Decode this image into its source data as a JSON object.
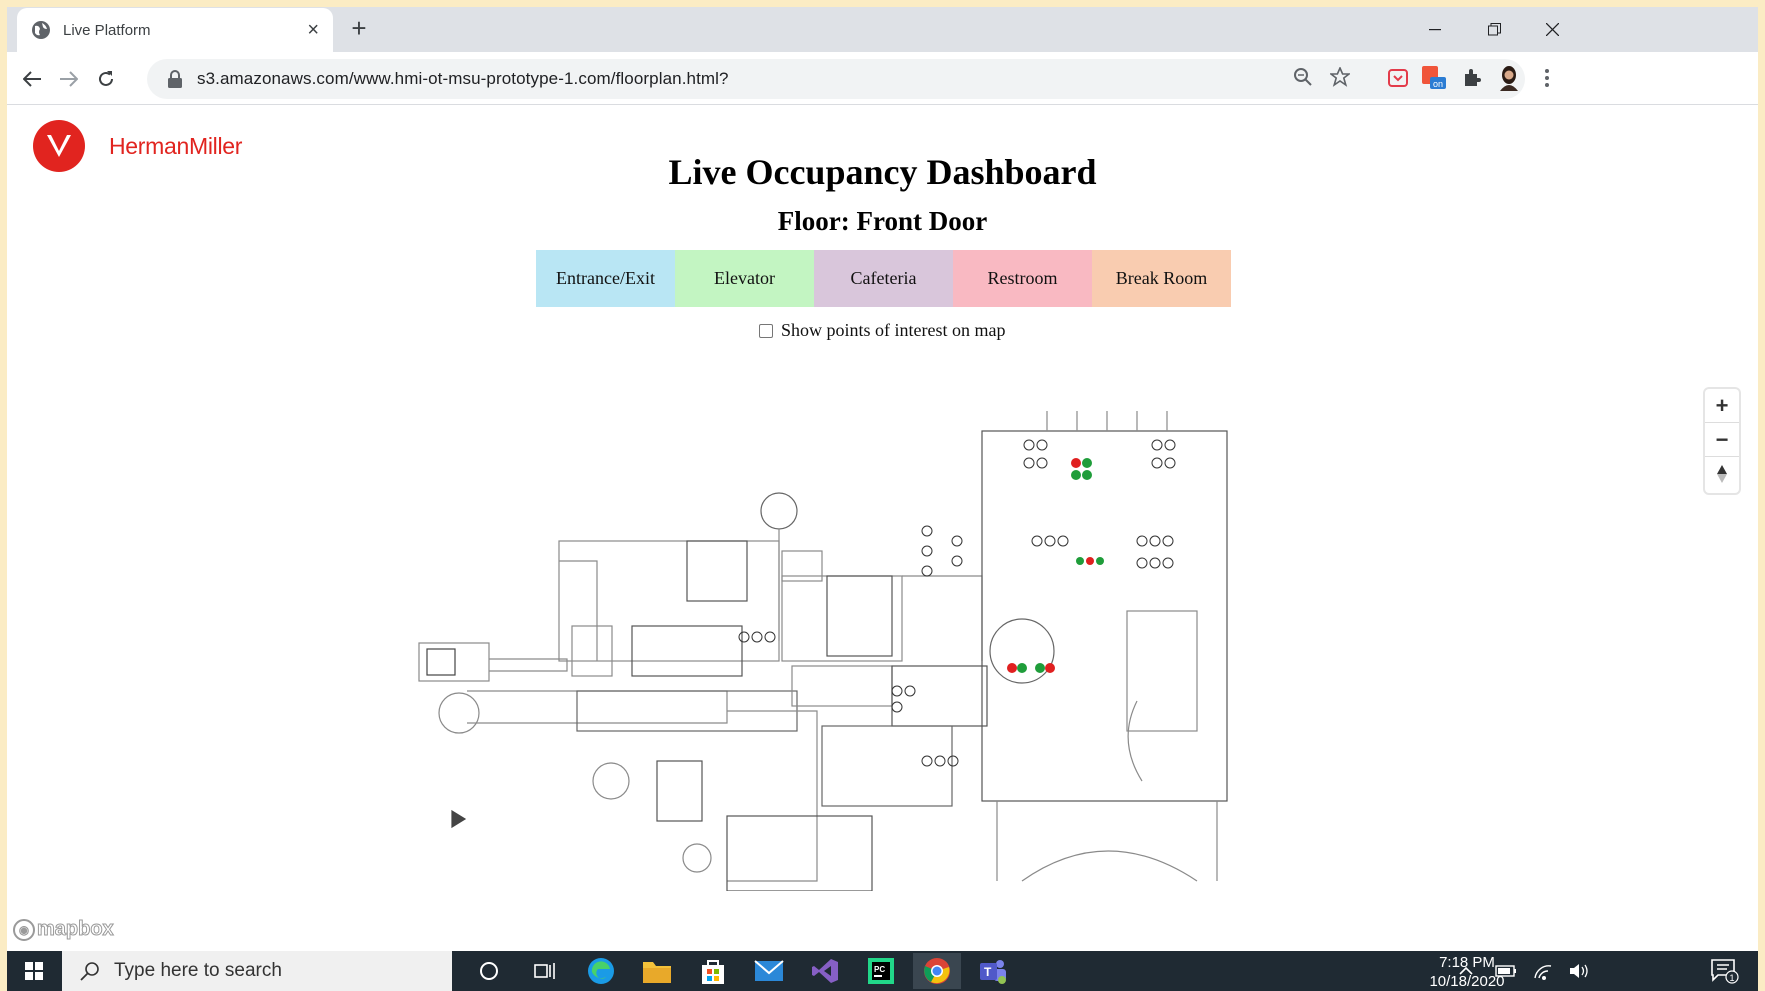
{
  "browser": {
    "tab_title": "Live Platform",
    "tab_close": "×",
    "new_tab": "+",
    "url": "s3.amazonaws.com/www.hmi-ot-msu-prototype-1.com/floorplan.html?"
  },
  "page": {
    "brand": "HermanMiller",
    "title": "Live Occupancy Dashboard",
    "floor": "Floor: Front Door",
    "legend": [
      {
        "label": "Entrance/Exit",
        "color": "#b9e6f4"
      },
      {
        "label": "Elevator",
        "color": "#c3f5c2"
      },
      {
        "label": "Cafeteria",
        "color": "#d9c6db"
      },
      {
        "label": "Restroom",
        "color": "#f9b9c2"
      },
      {
        "label": "Break Room",
        "color": "#f9ccb0"
      }
    ],
    "poi_label": "Show points of interest on map",
    "poi_checked": false,
    "map_attribution": "mapbox",
    "zoom_in": "+",
    "zoom_out": "−"
  },
  "taskbar": {
    "search_placeholder": "Type here to search",
    "time": "7:18 PM",
    "date": "10/18/2020",
    "notification_count": "1"
  },
  "colors": {
    "brand_red": "#e1241f",
    "occupied_red": "#e02020",
    "free_green": "#1f9d3a"
  }
}
